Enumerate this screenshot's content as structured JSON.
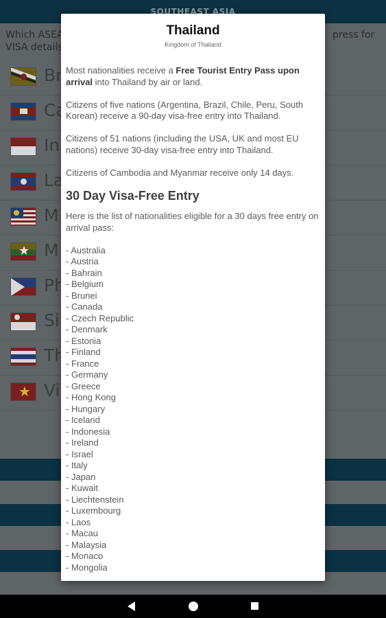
{
  "background_app": {
    "header_title": "SOUTHEAST ASIA",
    "intro_line1_left": "Which ASEA",
    "intro_line1_right": "press for",
    "intro_line2_left": "VISA details",
    "countries": [
      {
        "name": "Br",
        "flag": "brunei-flag-icon"
      },
      {
        "name": "Ca",
        "flag": "cambodia-flag-icon"
      },
      {
        "name": "In",
        "flag": "indonesia-flag-icon"
      },
      {
        "name": "La",
        "flag": "laos-flag-icon"
      },
      {
        "name": "M",
        "flag": "malaysia-flag-icon"
      },
      {
        "name": "M",
        "flag": "myanmar-flag-icon"
      },
      {
        "name": "Ph",
        "flag": "philippines-flag-icon"
      },
      {
        "name": "Si",
        "flag": "singapore-flag-icon"
      },
      {
        "name": "Th",
        "flag": "thailand-flag-icon"
      },
      {
        "name": "Vi",
        "flag": "vietnam-flag-icon"
      }
    ]
  },
  "dialog": {
    "title": "Thailand",
    "subtitle": "Kingdom of Thailand",
    "para1_pre": "Most nationalities receive a ",
    "para1_bold": "Free Tourist Entry Pass upon arrival",
    "para1_post": " into Thailand by air or land.",
    "para2": "Citizens of five nations (Argentina, Brazil, Chile, Peru, South Korean) receive a 90-day visa-free entry into Thailand.",
    "para3": "Citizens of 51 nations (including the USA, UK and most EU nations) receive 30-day visa-free entry into Thailand.",
    "para4": "Citizens of Cambodia and Myanmar receive only 14 days.",
    "heading": "30 Day Visa-Free Entry",
    "list_intro": "Here is the list of nationalities eligible for a 30 days free entry on arrival pass:",
    "nationalities": [
      "- Australia",
      "- Austria",
      "- Bahrain",
      "- Belgium",
      "- Brunei",
      "- Canada",
      "- Czech Republic",
      "- Denmark",
      "- Estonia",
      "- Finland",
      "- France",
      "- Germany",
      "- Greece",
      "- Hong Kong",
      "- Hungary",
      "- Iceland",
      "- Indonesia",
      "- Ireland",
      "- Israel",
      "- Italy",
      "- Japan",
      "- Kuwait",
      "- Liechtenstein",
      "- Luxembourg",
      "- Laos",
      "- Macau",
      "- Malaysia",
      "- Monaco",
      "- Mongolia"
    ]
  },
  "navbar": {
    "back": "back-icon",
    "home": "home-icon",
    "recents": "recents-icon"
  },
  "colors": {
    "header_bg": "#0b3142",
    "scrim_bg": "#5f6467",
    "dialog_bg": "#ffffff"
  }
}
